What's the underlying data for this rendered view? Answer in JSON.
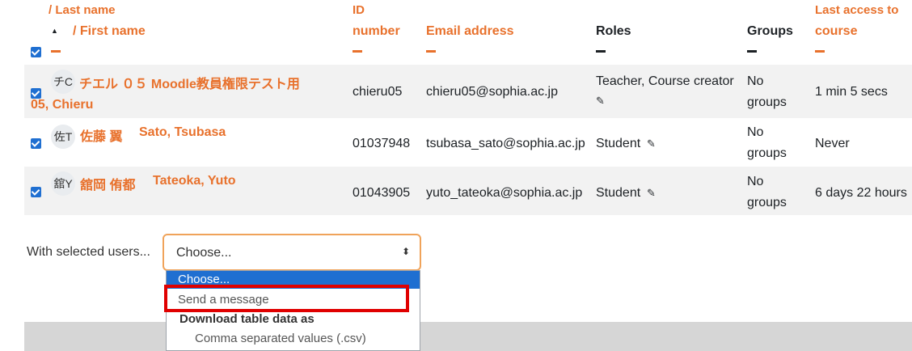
{
  "header": {
    "last_name": "/ Last name",
    "sort_arrow": "▲",
    "first_name": "/ First name",
    "id_line1": "ID",
    "id_line2": "number",
    "email": "Email address",
    "roles": "Roles",
    "groups": "Groups",
    "last_access_line1": "Last access to",
    "last_access_line2": "course"
  },
  "rows": [
    {
      "avatar": "チC",
      "name_line1": "チエル ０５ Moodle教員権限テスト用",
      "name_line2": "05, Chieru",
      "id": "chieru05",
      "email": "chieru05@sophia.ac.jp",
      "roles": "Teacher, Course creator",
      "groups_line1": "No",
      "groups_line2": "groups",
      "last_access": "1 min 5 secs"
    },
    {
      "avatar": "佐T",
      "name_jp": "佐藤 翼",
      "name_en": "Sato, Tsubasa",
      "id": "01037948",
      "email": "tsubasa_sato@sophia.ac.jp",
      "roles": "Student",
      "groups_line1": "No",
      "groups_line2": "groups",
      "last_access": "Never"
    },
    {
      "avatar": "舘Y",
      "name_jp": "舘岡 侑都",
      "name_en": "Tateoka, Yuto",
      "id": "01043905",
      "email": "yuto_tateoka@sophia.ac.jp",
      "roles": "Student",
      "groups_line1": "No",
      "groups_line2": "groups",
      "last_access": "6 days 22 hours"
    }
  ],
  "bulk": {
    "label": "With selected users...",
    "selected": "Choose...",
    "options": {
      "choose": "Choose...",
      "send_message": "Send a message",
      "group_download": "Download table data as",
      "csv": "Comma separated values (.csv)"
    }
  },
  "icons": {
    "pencil": "✎",
    "select_arrows": "⬍"
  },
  "colors": {
    "accent": "#e8712c",
    "checkbox": "#1f6fd1",
    "highlight_box": "#e00000",
    "dropdown_selected": "#1f6fd1"
  }
}
